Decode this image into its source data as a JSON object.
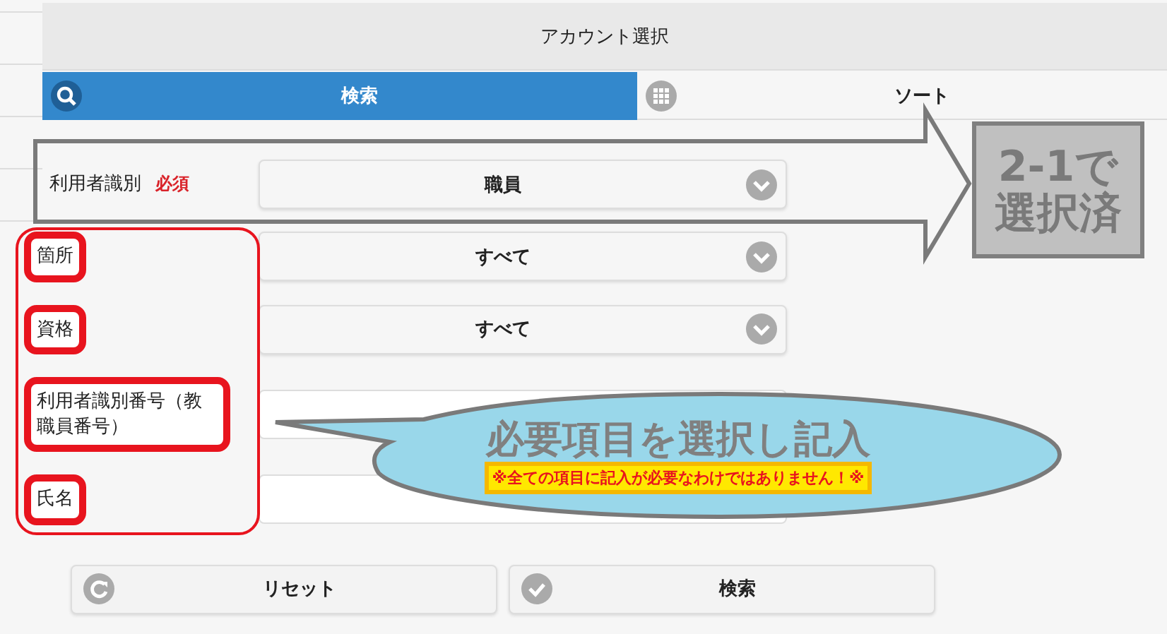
{
  "window": {
    "title": "アカウント選択"
  },
  "tabs": [
    {
      "label": "検索",
      "selected": true
    },
    {
      "label": "ソート",
      "selected": false
    }
  ],
  "fields": [
    {
      "label": "利用者識別",
      "required_badge": "必須",
      "kind": "select",
      "value": "職員",
      "highlighted": false
    },
    {
      "label": "箇所",
      "kind": "select",
      "value": "すべて",
      "highlighted": true
    },
    {
      "label": "資格",
      "kind": "select",
      "value": "すべて",
      "highlighted": true
    },
    {
      "label": "利用者識別番号（教職員番号）",
      "kind": "input",
      "highlighted": true
    },
    {
      "label": "氏名",
      "kind": "input",
      "highlighted": true
    }
  ],
  "buttons": [
    {
      "label": "リセット"
    },
    {
      "label": "検索"
    }
  ],
  "annotations": {
    "selected_note": [
      "2-1で",
      "選択済"
    ],
    "bubble_title": "必要項目を選択し記入",
    "bubble_note": "※全ての項目に記入が必要なわけではありません！※"
  }
}
